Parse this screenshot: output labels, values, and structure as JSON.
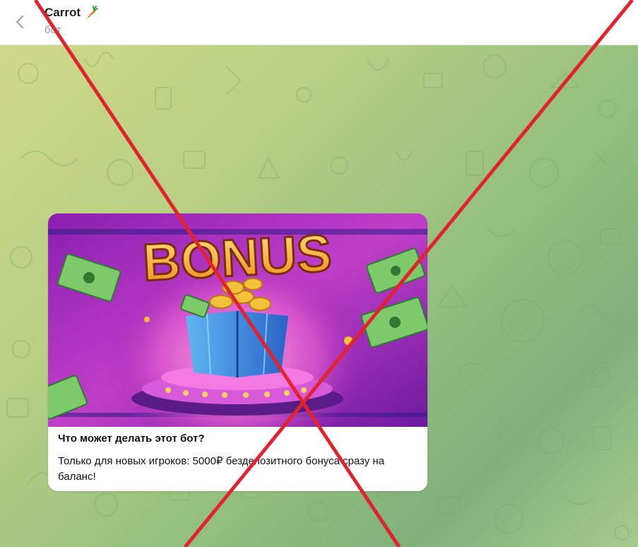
{
  "header": {
    "title": "Carrot",
    "subtitle": "бот"
  },
  "message": {
    "image_text": "BONUS",
    "title": "Что может делать этот бот?",
    "text": "Только для новых игроков: 5000₽ бездепозитного бонуса сразу на баланс!"
  },
  "icons": {
    "back": "arrow-left-icon",
    "carrot": "carrot-icon"
  },
  "colors": {
    "cross": "#e0232e",
    "accent_purple": "#a53fc9"
  }
}
